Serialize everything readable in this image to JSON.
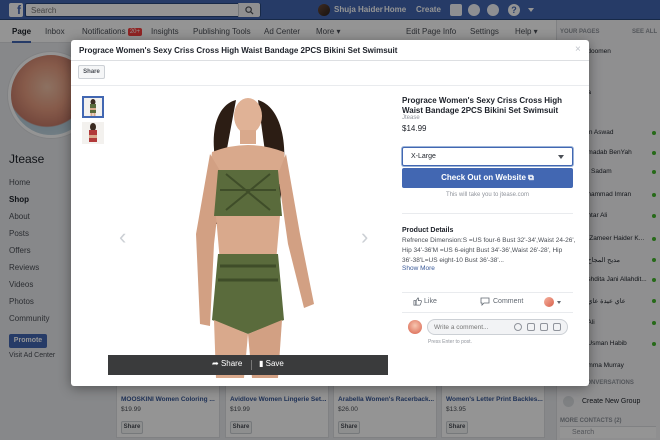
{
  "topbar": {
    "logo": "f",
    "search_placeholder": "Search",
    "user_name": "Shuja Haider",
    "home": "Home",
    "create": "Create",
    "help_glyph": "?"
  },
  "page_nav": {
    "page": "Page",
    "inbox": "Inbox",
    "notifications": "Notifications",
    "notifications_badge": "20+",
    "insights": "Insights",
    "publishing_tools": "Publishing Tools",
    "ad_center": "Ad Center",
    "more": "More ▾",
    "edit_page_info": "Edit Page Info",
    "settings": "Settings",
    "help": "Help ▾"
  },
  "left": {
    "page_name": "Jtease",
    "items": [
      "Home",
      "Shop",
      "About",
      "Posts",
      "Offers",
      "Reviews",
      "Videos",
      "Photos",
      "Community"
    ],
    "active": "Shop",
    "promote": "Promote",
    "visit_ad_center": "Visit Ad Center"
  },
  "right": {
    "your_pages": "YOUR PAGES",
    "see_all": "SEE ALL",
    "contacts": [
      "...doomen",
      "...",
      "...a",
      "...",
      "...in Aswad",
      "...madab BenYah",
      "...t Sadam",
      "...hammad Imran",
      "...htar Ali",
      "... Zameer Haider K...",
      "...مديح المجاح",
      "...shdita Jani Allahdit...",
      "...عاي عيدة عاي",
      "...Ali",
      "...Usman Habib",
      "...mma Murray"
    ],
    "conversations": "CONVERSATIONS",
    "create_new_group": "Create New Group",
    "more_contacts": "MORE CONTACTS (2)",
    "chat_search_placeholder": "Search"
  },
  "background_products": [
    {
      "title": "MOOSKINI Women Coloring ...",
      "price": "$19.99",
      "share": "Share"
    },
    {
      "title": "Avidlove Women Lingerie Set...",
      "price": "$19.99",
      "share": "Share"
    },
    {
      "title": "Arabella Women's Racerback...",
      "price": "$26.00",
      "share": "Share"
    },
    {
      "title": "Women's Letter Print Backles...",
      "price": "$13.95",
      "share": "Share"
    }
  ],
  "modal": {
    "title": "Prograce Women's Sexy Criss Cross High Waist Bandage 2PCS Bikini Set Swimsuit",
    "close": "×",
    "share_label": "Share",
    "image_share": "Share",
    "image_save": "Save",
    "product": {
      "title": "Prograce Women's Sexy Criss Cross High Waist Bandage 2PCS Bikini Set Swimsuit",
      "vendor": "Jtease",
      "price": "$14.99",
      "size_selected": "X-Large",
      "checkout": "Check Out on Website ⧉",
      "redirect_note": "This will take you to jtease.com",
      "details_header": "Product Details",
      "details_text": "Refrence Dimension:S =US four-6 Bust 32'-34',Waist 24-26', Hip 34'-36'M =US 6-eight Bust 34'-36',Waist 26'-28', Hip 36'-38'L=US eight-10 Bust 36'-38'...",
      "show_more": "Show More"
    },
    "actions": {
      "like": "Like",
      "comment": "Comment"
    },
    "comment_placeholder": "Write a comment...",
    "enter_note": "Press Enter to post."
  },
  "colors": {
    "brand": "#4267b2",
    "product_green": "#5a6b3c"
  }
}
